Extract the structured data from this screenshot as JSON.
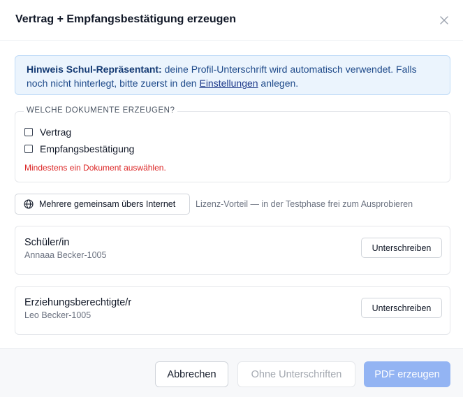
{
  "dialog": {
    "title": "Vertrag + Empfangsbestätigung erzeugen",
    "close_icon": "close-icon"
  },
  "notice": {
    "bold": "Hinweis Schul-Repräsentant:",
    "text_before_link": " deine Profil-Unterschrift wird automatisch verwendet. Falls noch nicht hinterlegt, bitte zuerst in den ",
    "link": "Einstellungen",
    "text_after_link": " anlegen.",
    "colors": {
      "background": "#ebf4fd",
      "border": "#bfdbf7",
      "text": "#1e4a8a"
    }
  },
  "documents": {
    "legend": "WELCHE DOKUMENTE ERZEUGEN?",
    "options": [
      {
        "label": "Vertrag",
        "checked": false
      },
      {
        "label": "Empfangsbestätigung",
        "checked": false
      }
    ],
    "error": "Mindestens ein Dokument auswählen."
  },
  "internet": {
    "button_label": "Mehrere gemeinsam übers Internet",
    "icon": "globe-icon",
    "hint": "Lizenz-Vorteil — in der Testphase frei zum Ausprobieren"
  },
  "signers": [
    {
      "role": "Schüler/in",
      "name": "Annaaa Becker-1005",
      "button": "Unterschreiben"
    },
    {
      "role": "Erziehungsberechtigte/r",
      "name": "Leo Becker-1005",
      "button": "Unterschreiben"
    }
  ],
  "footer": {
    "cancel": "Abbrechen",
    "no_signatures": "Ohne Unterschriften",
    "generate_pdf": "PDF erzeugen",
    "colors": {
      "primary_disabled": "#93b4f3",
      "error": "#dc2626"
    }
  }
}
